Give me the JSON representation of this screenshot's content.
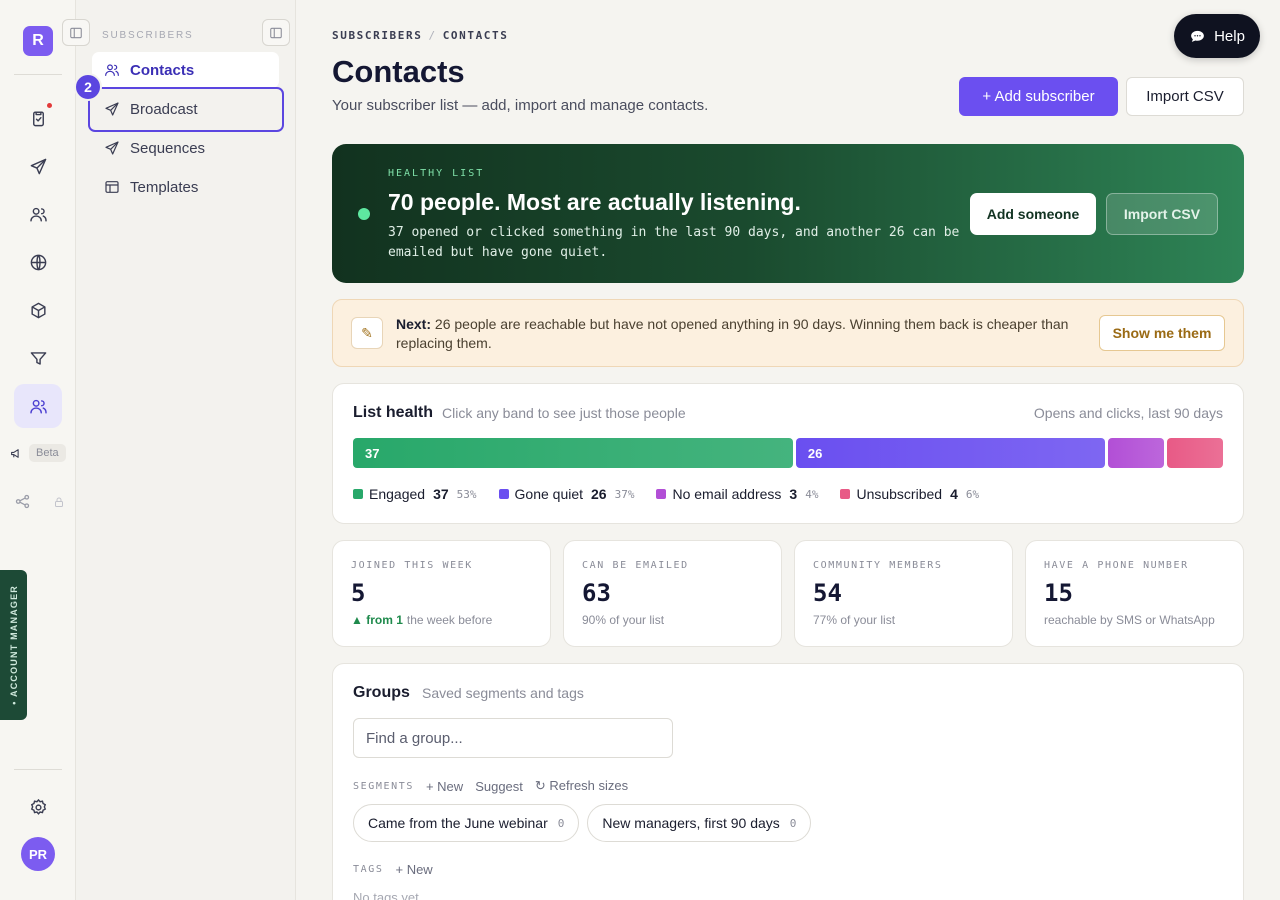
{
  "rail": {
    "logo": "R",
    "beta": "Beta",
    "account_manager": "• ACCOUNT MANAGER",
    "avatar": "PR"
  },
  "subnav": {
    "header": "SUBSCRIBERS",
    "items": [
      {
        "label": "Contacts",
        "icon": "users-icon"
      },
      {
        "label": "Broadcast",
        "icon": "send-icon"
      },
      {
        "label": "Sequences",
        "icon": "send-icon"
      },
      {
        "label": "Templates",
        "icon": "layout-icon"
      }
    ],
    "step_badge": "2"
  },
  "header": {
    "breadcrumb": [
      "SUBSCRIBERS",
      "CONTACTS"
    ],
    "title": "Contacts",
    "subtitle": "Your subscriber list — add, import and manage contacts.",
    "add_button": "+ Add subscriber",
    "import_button": "Import CSV",
    "help": "Help"
  },
  "hero": {
    "eyebrow": "HEALTHY LIST",
    "headline": "70 people. Most are actually listening.",
    "description": "37 opened or clicked something in the last 90 days, and another 26 can be emailed but have gone quiet.",
    "add_button": "Add someone",
    "import_button": "Import CSV"
  },
  "next": {
    "label": "Next:",
    "text": "26 people are reachable but have not opened anything in 90 days. Winning them back is cheaper than replacing them.",
    "button": "Show me them",
    "icon": "✎"
  },
  "list_health": {
    "title": "List health",
    "hint": "Click any band to see just those people",
    "period": "Opens and clicks, last 90 days",
    "bands": [
      {
        "name": "Engaged",
        "count": 37,
        "count_label": "37",
        "pct": "53%",
        "color": "#28a86a",
        "bar_label": "37"
      },
      {
        "name": "Gone quiet",
        "count": 26,
        "count_label": "26",
        "pct": "37%",
        "color": "#6a4ff0",
        "bar_label": "26"
      },
      {
        "name": "No email address",
        "count": 3,
        "count_label": "3",
        "pct": "4%",
        "color": "#b24fd6",
        "bar_label": ""
      },
      {
        "name": "Unsubscribed",
        "count": 4,
        "count_label": "4",
        "pct": "6%",
        "color": "#e85a86",
        "bar_label": ""
      }
    ]
  },
  "stats": [
    {
      "label": "JOINED THIS WEEK",
      "value": "5",
      "up": "▲ from 1",
      "sub": "the week before"
    },
    {
      "label": "CAN BE EMAILED",
      "value": "63",
      "up": "",
      "sub": "90% of your list"
    },
    {
      "label": "COMMUNITY MEMBERS",
      "value": "54",
      "up": "",
      "sub": "77% of your list"
    },
    {
      "label": "HAVE A PHONE NUMBER",
      "value": "15",
      "up": "",
      "sub": "reachable by SMS or WhatsApp"
    }
  ],
  "groups": {
    "title": "Groups",
    "hint": "Saved segments and tags",
    "search_placeholder": "Find a group...",
    "segments_label": "SEGMENTS",
    "new": "+ New",
    "suggest": "Suggest",
    "refresh": "↻ Refresh sizes",
    "segments": [
      {
        "name": "Came from the June webinar",
        "count": "0"
      },
      {
        "name": "New managers, first 90 days",
        "count": "0"
      }
    ],
    "tags_label": "TAGS",
    "tags_new": "+ New",
    "no_tags": "No tags yet"
  }
}
